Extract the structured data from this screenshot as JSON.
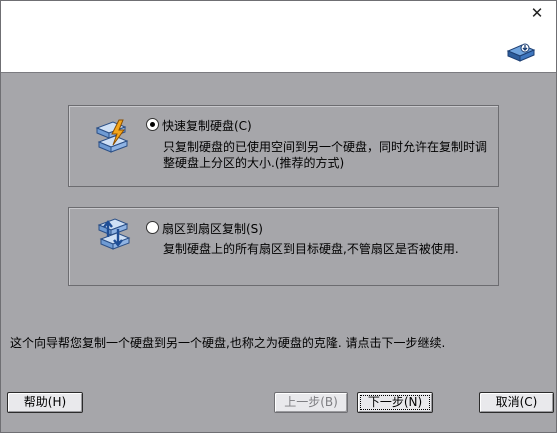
{
  "window": {
    "close_glyph": "✕"
  },
  "options": [
    {
      "title": "快速复制硬盘(C)",
      "selected": true,
      "icon": "fast-copy-disk-icon",
      "desc_line1": "只复制硬盘的已使用空间到另一个硬盘，同时允许在复制时调",
      "desc_line2": "整硬盘上分区的大小.(推荐的方式)"
    },
    {
      "title": "扇区到扇区复制(S)",
      "selected": false,
      "icon": "sector-copy-disk-icon",
      "desc_line1": "复制硬盘上的所有扇区到目标硬盘,不管扇区是否被使用."
    }
  ],
  "info_text": "这个向导帮您复制一个硬盘到另一个硬盘,也称之为硬盘的克隆. 请点击下一步继续.",
  "buttons": {
    "help": "帮助(H)",
    "back": "上一步(B)",
    "next": "下一步(N)",
    "cancel": "取消(C)"
  },
  "colors": {
    "background": "#a6a6aa",
    "header": "#ffffff",
    "accent_orange": "#f3a51b",
    "accent_blue": "#2f6fc0"
  }
}
